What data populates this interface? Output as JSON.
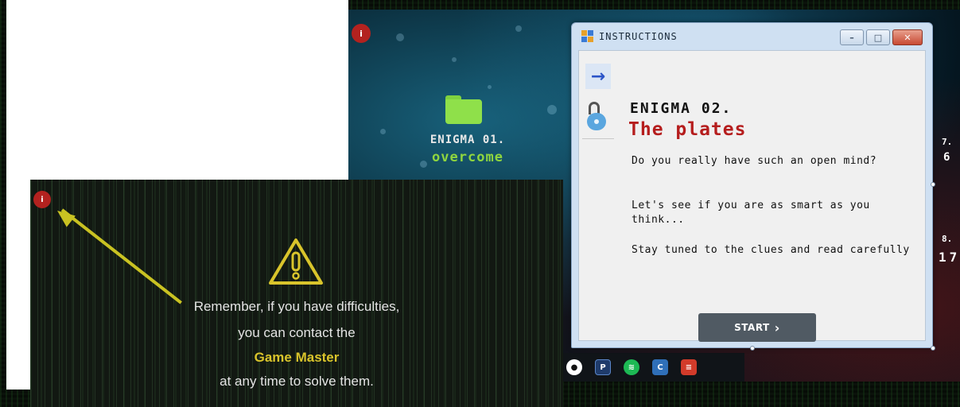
{
  "desktop": {
    "info_badge": "i",
    "enigma1": {
      "label": "ENIGMA 01.",
      "status": "overcome"
    },
    "side_digits": [
      "7.",
      "6",
      "8.",
      "17"
    ],
    "taskbar_icons": [
      "app-icon",
      "pinned-icon",
      "spotify-icon",
      "store-icon",
      "red-app-icon"
    ]
  },
  "dialog": {
    "title": "INSTRUCTIONS",
    "window_buttons": {
      "minimize": "–",
      "maximize": "□",
      "close": "✕"
    },
    "enigma_number": "ENIGMA 02.",
    "enigma_name": "The plates",
    "paragraphs": [
      "Do you really have such an open mind?",
      "Let's see if you are as smart as you think...",
      "Stay tuned to the clues and read carefully"
    ],
    "start_label": "START",
    "start_chevron": "›"
  },
  "popup": {
    "info_badge": "i",
    "lines": [
      "Remember, if you have difficulties,",
      "you can contact the",
      "Game Master",
      "at any time to solve them."
    ],
    "accent_color": "#d9c42b"
  }
}
